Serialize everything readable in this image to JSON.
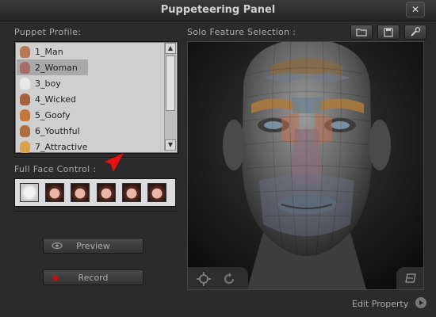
{
  "window": {
    "title": "Puppeteering Panel",
    "close_glyph": "✕"
  },
  "left": {
    "puppet_profile_label": "Puppet Profile:",
    "profiles": [
      {
        "label": "1_Man",
        "icon": "male-head-icon",
        "color": "#b57a55"
      },
      {
        "label": "2_Woman",
        "icon": "female-head-icon",
        "color": "#a86e6a",
        "selected": true
      },
      {
        "label": "3_boy",
        "icon": "boy-head-icon",
        "color": "#e8e8e8"
      },
      {
        "label": "4_Wicked",
        "icon": "wicked-head-icon",
        "color": "#a46240"
      },
      {
        "label": "5_Goofy",
        "icon": "goofy-head-icon",
        "color": "#c6763b"
      },
      {
        "label": "6_Youthful",
        "icon": "youthful-head-icon",
        "color": "#b06d3f"
      },
      {
        "label": "7_Attractive",
        "icon": "attractive-head-icon",
        "color": "#d9a24a"
      }
    ],
    "full_face_label": "Full Face Control :",
    "preview_label": "Preview",
    "record_label": "Record"
  },
  "right": {
    "solo_feature_label": "Solo Feature Selection :",
    "edit_property_label": "Edit Property"
  },
  "colors": {
    "accent_arrow": "#e81010",
    "record_dot": "#c01010"
  }
}
